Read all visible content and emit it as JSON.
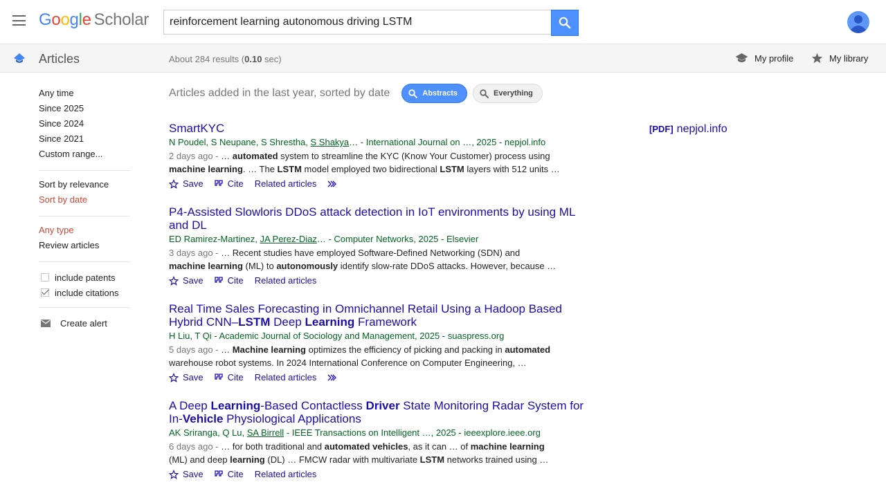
{
  "header": {
    "logo_google": "Google",
    "logo_scholar": "Scholar",
    "search_value": "reinforcement learning autonomous driving LSTM"
  },
  "subbar": {
    "section_title": "Articles",
    "results_prefix": "About 284 results (",
    "results_time": "0.10",
    "results_suffix": " sec)",
    "my_profile": "My profile",
    "my_library": "My library"
  },
  "sidebar": {
    "time_filters": [
      "Any time",
      "Since 2025",
      "Since 2024",
      "Since 2021",
      "Custom range..."
    ],
    "sort_options": [
      "Sort by relevance",
      "Sort by date"
    ],
    "type_options": [
      "Any type",
      "Review articles"
    ],
    "include_patents": "include patents",
    "include_citations": "include citations",
    "create_alert": "Create alert"
  },
  "filter_bar": {
    "text": "Articles added in the last year, sorted by date",
    "chip_abstracts": "Abstracts",
    "chip_everything": "Everything"
  },
  "actions": {
    "save": "Save",
    "cite": "Cite",
    "related": "Related articles"
  },
  "side_link": {
    "tag": "[PDF]",
    "domain": "nepjol.info"
  },
  "colors": {
    "link": "#1a0dab",
    "author_green": "#006621",
    "active_red": "#d14836",
    "accent_blue": "#4d90fe"
  },
  "results": [
    {
      "title_parts": [
        {
          "t": "SmartKYC",
          "b": false
        }
      ],
      "authors_pre": "N Poudel, S Neupane, S Shrestha, ",
      "authors_link": "S Shakya",
      "authors_post": "… - International Journal on …, 2025 - nepjol.info",
      "date": "2 days ago",
      "snippet_parts": [
        {
          "t": " - … ",
          "b": false
        },
        {
          "t": "automated",
          "b": true
        },
        {
          "t": " system to streamline the KYC (Know Your Customer) process using ",
          "b": false
        },
        {
          "br": true
        },
        {
          "t": "machine learning",
          "b": true
        },
        {
          "t": ". … The ",
          "b": false
        },
        {
          "t": "LSTM",
          "b": true
        },
        {
          "t": " model employed two bidirectional ",
          "b": false
        },
        {
          "t": "LSTM",
          "b": true
        },
        {
          "t": " layers with 512 units …",
          "b": false
        }
      ],
      "has_more": true
    },
    {
      "title_parts": [
        {
          "t": "P4-Assisted Slowloris DDoS attack detection in IoT environments by using ML and DL",
          "b": false
        }
      ],
      "authors_pre": "ED Ramirez-Martinez, ",
      "authors_link": "JA Perez-Diaz",
      "authors_post": "… - Computer Networks, 2025 - Elsevier",
      "date": "3 days ago",
      "snippet_parts": [
        {
          "t": " - … Recent studies have employed Software-Defined Networking (SDN) and ",
          "b": false
        },
        {
          "br": true
        },
        {
          "t": "machine learning",
          "b": true
        },
        {
          "t": " (ML) to ",
          "b": false
        },
        {
          "t": "autonomously",
          "b": true
        },
        {
          "t": " identify slow-rate DDoS attacks. However, because …",
          "b": false
        }
      ],
      "has_more": false
    },
    {
      "title_parts": [
        {
          "t": "Real Time Sales Forecasting in Omnichannel Retail Using a Hadoop Based Hybrid CNN–",
          "b": false
        },
        {
          "t": "LSTM",
          "b": true
        },
        {
          "t": " Deep ",
          "b": false
        },
        {
          "t": "Learning",
          "b": true
        },
        {
          "t": " Framework",
          "b": false
        }
      ],
      "authors_pre": "H Liu, T Qi - Academic Journal of Sociology and Management, 2025 - suaspress.org",
      "authors_link": "",
      "authors_post": "",
      "date": "5 days ago",
      "snippet_parts": [
        {
          "t": " - … ",
          "b": false
        },
        {
          "t": "Machine learning",
          "b": true
        },
        {
          "t": " optimizes the efficiency of picking and packing in ",
          "b": false
        },
        {
          "t": "automated",
          "b": true
        },
        {
          "br": true
        },
        {
          "t": "warehouse robot systems. In 2024 International Conference on Computer Engineering, …",
          "b": false
        }
      ],
      "has_more": true
    },
    {
      "title_parts": [
        {
          "t": "A Deep ",
          "b": false
        },
        {
          "t": "Learning",
          "b": true
        },
        {
          "t": "-Based Contactless ",
          "b": false
        },
        {
          "t": "Driver",
          "b": true
        },
        {
          "t": " State Monitoring Radar System for In-",
          "b": false
        },
        {
          "t": "Vehicle",
          "b": true
        },
        {
          "t": " Physiological Applications",
          "b": false
        }
      ],
      "authors_pre": "AK Sriranga, Q Lu, ",
      "authors_link": "SA Birrell",
      "authors_post": " - IEEE Transactions on Intelligent …, 2025 - ieeexplore.ieee.org",
      "date": "6 days ago",
      "snippet_parts": [
        {
          "t": " - … for both traditional and ",
          "b": false
        },
        {
          "t": "automated vehicles",
          "b": true
        },
        {
          "t": ", as it can … of ",
          "b": false
        },
        {
          "t": "machine learning",
          "b": true
        },
        {
          "br": true
        },
        {
          "t": "(ML) and deep ",
          "b": false
        },
        {
          "t": "learning",
          "b": true
        },
        {
          "t": " (DL) … FMCW radar with multivariate ",
          "b": false
        },
        {
          "t": "LSTM",
          "b": true
        },
        {
          "t": " networks trained using …",
          "b": false
        }
      ],
      "has_more": false
    }
  ]
}
